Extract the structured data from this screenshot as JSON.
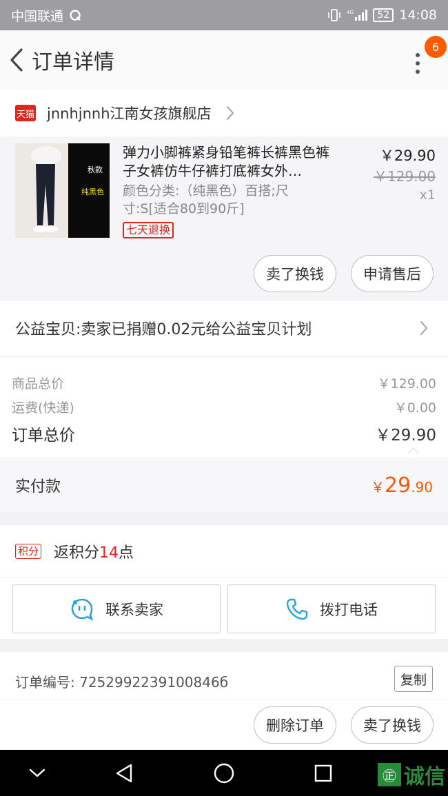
{
  "status_bar": {
    "carrier": "中国联通",
    "signal": "4G",
    "battery": "52",
    "time": "14:08"
  },
  "header": {
    "title": "订单详情",
    "badge_count": "6"
  },
  "shop": {
    "logo_text": "天猫",
    "name": "jnnhjnnh江南女孩旗舰店"
  },
  "product": {
    "image_tag1": "秋款",
    "image_tag2": "纯黑色",
    "title": "弹力小脚裤紧身铅笔裤长裤黑色裤子女裤仿牛仔裤打底裤女外…",
    "spec": "颜色分类:（纯黑色）百搭;尺寸:S[适合80到90斤]",
    "return_tag": "七天退换",
    "price": "￥29.90",
    "original_price": "￥129.00",
    "quantity": "x1",
    "actions": [
      "卖了换钱",
      "申请售后"
    ]
  },
  "charity": {
    "text": "公益宝贝:卖家已捐赠0.02元给公益宝贝计划"
  },
  "price_summary": {
    "items_label": "商品总价",
    "items_value": "￥129.00",
    "shipping_label": "运费(快递)",
    "shipping_value": "￥0.00",
    "total_label": "订单总价",
    "total_value": "￥29.90"
  },
  "paid": {
    "label": "实付款",
    "currency": "￥",
    "integer": "29",
    "decimal": ".90"
  },
  "points": {
    "tag": "积分",
    "prefix": "返积分",
    "count": "14",
    "suffix": "点"
  },
  "contact": {
    "seller_label": "联系卖家",
    "phone_label": "拨打电话"
  },
  "order": {
    "number_text": "订单编号: 7252992239100846б",
    "copy_label": "复制"
  },
  "bottom_actions": [
    "删除订单",
    "卖了换钱"
  ],
  "watermark": {
    "logo": "㊣",
    "text": "诚信"
  },
  "colors": {
    "accent_orange": "#ff5500",
    "tmall_red": "#e1251b",
    "link_blue": "#2aa4e0"
  }
}
